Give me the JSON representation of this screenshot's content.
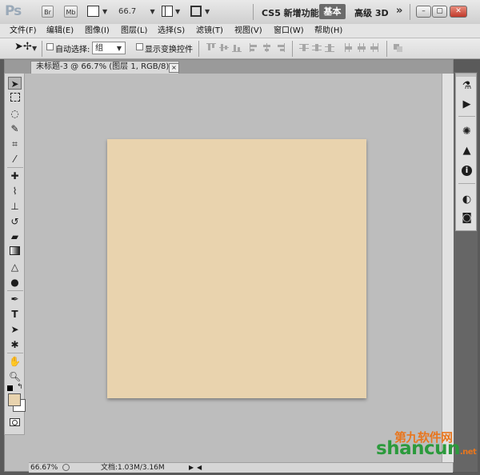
{
  "appbar": {
    "logo": "Ps",
    "bridge_button": "Br",
    "minibridge_button": "Mb",
    "zoom_value": "66.7",
    "workspace_cs5": "CS5 新增功能",
    "workspace_basic": "基本",
    "workspace_3d": "高级 3D",
    "more": "»",
    "window_buttons": [
      "minimize",
      "restore",
      "close"
    ]
  },
  "menubar": {
    "items": [
      "文件(F)",
      "编辑(E)",
      "图像(I)",
      "图层(L)",
      "选择(S)",
      "滤镜(T)",
      "视图(V)",
      "窗口(W)",
      "帮助(H)"
    ]
  },
  "optionsbar": {
    "auto_select_label": "自动选择:",
    "auto_select_value": "组",
    "show_transform_label": "显示变换控件"
  },
  "document": {
    "tab_title": "未标题-3 @ 66.7% (图层 1, RGB/8) *",
    "tab_close": "×",
    "canvas_color": "#e9d3ae",
    "zoom_status": "66.67%",
    "doc_info": "文档:1.03M/3.16M"
  },
  "tools": {
    "foreground_color": "#e8d3ae",
    "background_color": "#ffffff",
    "icons": [
      "move-tool-icon",
      "marquee-tool-icon",
      "lasso-tool-icon",
      "quick-select-tool-icon",
      "crop-tool-icon",
      "eyedropper-tool-icon",
      "healing-brush-icon",
      "brush-tool-icon",
      "clone-stamp-icon",
      "history-brush-icon",
      "eraser-tool-icon",
      "gradient-tool-icon",
      "blur-tool-icon",
      "dodge-tool-icon",
      "pen-tool-icon",
      "type-tool-icon",
      "path-select-icon",
      "shape-tool-icon",
      "hand-tool-icon",
      "zoom-tool-icon"
    ]
  },
  "panels": {
    "icons": [
      "color-panel-icon",
      "actions-panel-icon",
      "adjustments-panel-icon",
      "histogram-panel-icon",
      "info-panel-icon",
      "masks-panel-icon",
      "layers-panel-icon"
    ]
  },
  "watermark": {
    "main": "shancun",
    "cn": "第九软件网",
    "suffix": ".net"
  }
}
